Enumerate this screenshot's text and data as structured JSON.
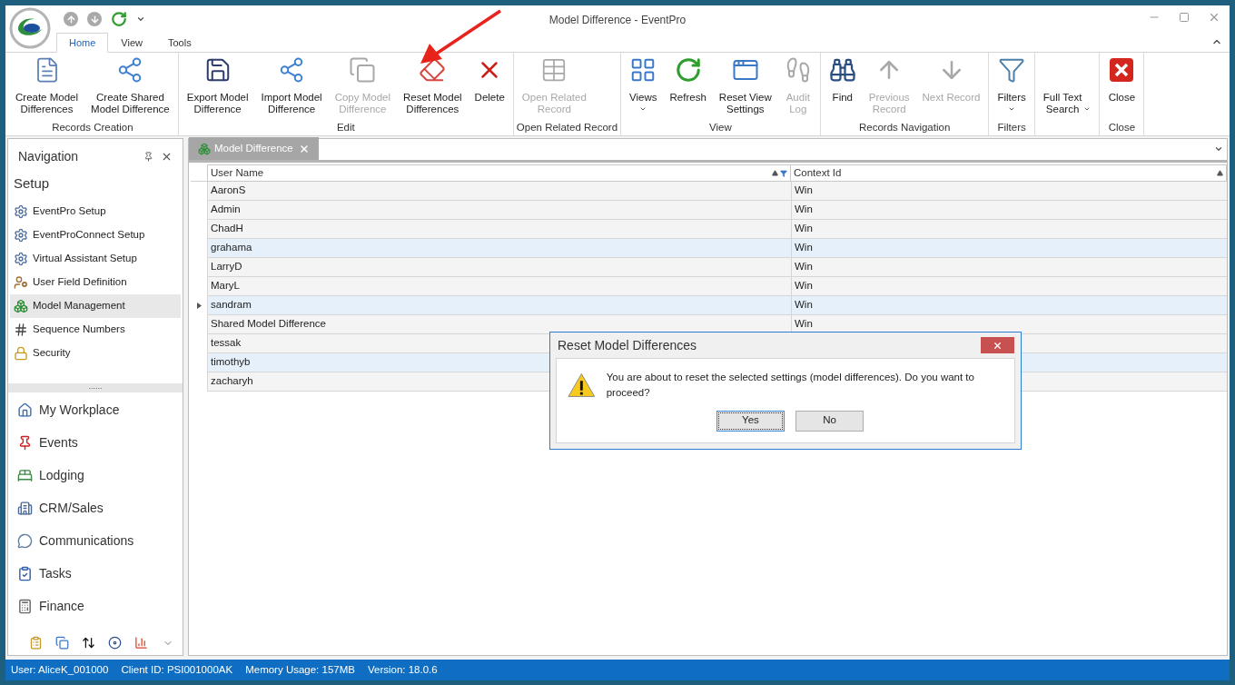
{
  "window": {
    "title": "Model Difference - EventPro"
  },
  "ribbon_tabs": [
    {
      "label": "Home",
      "selected": true
    },
    {
      "label": "View",
      "selected": false
    },
    {
      "label": "Tools",
      "selected": false
    }
  ],
  "ribbon_groups": [
    {
      "label": "Records Creation",
      "buttons": [
        {
          "label": "Create Model\nDifferences",
          "disabled": false,
          "menu": false
        },
        {
          "label": "Create Shared\nModel Difference",
          "disabled": false,
          "menu": false
        }
      ]
    },
    {
      "label": "Edit",
      "buttons": [
        {
          "label": "Export Model\nDifference",
          "disabled": false,
          "menu": false
        },
        {
          "label": "Import Model\nDifference",
          "disabled": false,
          "menu": false
        },
        {
          "label": "Copy Model\nDifference",
          "disabled": true,
          "menu": false
        },
        {
          "label": "Reset Model\nDifferences",
          "disabled": false,
          "menu": false
        },
        {
          "label": "Delete",
          "disabled": false,
          "menu": false
        }
      ]
    },
    {
      "label": "Open Related Record",
      "buttons": [
        {
          "label": "Open Related\nRecord",
          "disabled": true,
          "menu": false
        }
      ]
    },
    {
      "label": "View",
      "buttons": [
        {
          "label": "Views",
          "disabled": false,
          "menu": true
        },
        {
          "label": "Refresh",
          "disabled": false,
          "menu": false
        },
        {
          "label": "Reset View\nSettings",
          "disabled": false,
          "menu": false
        },
        {
          "label": "Audit\nLog",
          "disabled": true,
          "menu": false
        }
      ]
    },
    {
      "label": "Records Navigation",
      "buttons": [
        {
          "label": "Find",
          "disabled": false,
          "menu": false
        },
        {
          "label": "Previous\nRecord",
          "disabled": true,
          "menu": false
        },
        {
          "label": "Next Record",
          "disabled": true,
          "menu": false
        }
      ]
    },
    {
      "label": "Filters",
      "buttons": [
        {
          "label": "Filters",
          "disabled": false,
          "menu": true
        }
      ]
    },
    {
      "buttons": [
        {
          "label": "Full Text\nSearch",
          "disabled": false,
          "menu": true
        }
      ]
    },
    {
      "label": "Close",
      "buttons": [
        {
          "label": "Close",
          "disabled": false,
          "menu": false
        }
      ]
    }
  ],
  "navigation": {
    "title": "Navigation",
    "section": "Setup",
    "items": [
      {
        "label": "EventPro Setup",
        "selected": false
      },
      {
        "label": "EventProConnect Setup",
        "selected": false
      },
      {
        "label": "Virtual Assistant Setup",
        "selected": false
      },
      {
        "label": "User Field Definition",
        "selected": false
      },
      {
        "label": "Model Management",
        "selected": true
      },
      {
        "label": "Sequence Numbers",
        "selected": false
      },
      {
        "label": "Security",
        "selected": false
      }
    ],
    "splitter": "......",
    "modules": [
      "My Workplace",
      "Events",
      "Lodging",
      "CRM/Sales",
      "Communications",
      "Tasks",
      "Finance"
    ]
  },
  "document_tab": {
    "label": "Model Difference"
  },
  "table": {
    "columns": [
      {
        "label": "User Name",
        "filtered": true
      },
      {
        "label": "Context Id",
        "filtered": false
      }
    ],
    "rows": [
      {
        "user_name": "AaronS",
        "context_id": "Win",
        "selected": false,
        "current": false
      },
      {
        "user_name": "Admin",
        "context_id": "Win",
        "selected": false,
        "current": false
      },
      {
        "user_name": "ChadH",
        "context_id": "Win",
        "selected": false,
        "current": false
      },
      {
        "user_name": "grahama",
        "context_id": "Win",
        "selected": true,
        "current": false
      },
      {
        "user_name": "LarryD",
        "context_id": "Win",
        "selected": false,
        "current": false
      },
      {
        "user_name": "MaryL",
        "context_id": "Win",
        "selected": false,
        "current": false
      },
      {
        "user_name": "sandram",
        "context_id": "Win",
        "selected": true,
        "current": true
      },
      {
        "user_name": "Shared Model Difference",
        "context_id": "Win",
        "selected": false,
        "current": false
      },
      {
        "user_name": "tessak",
        "selected": false,
        "current": false
      },
      {
        "user_name": "timothyb",
        "selected": true,
        "current": false
      },
      {
        "user_name": "zacharyh",
        "selected": false,
        "current": false
      }
    ]
  },
  "dialog": {
    "title": "Reset Model Differences",
    "message": "You are about to reset the selected settings (model differences). Do you want to proceed?",
    "buttons": [
      {
        "label": "Yes",
        "selected": true
      },
      {
        "label": "No",
        "selected": false
      }
    ]
  },
  "status_bar": [
    "User: AliceK_001000",
    "Client ID: PSI001000AK",
    "Memory Usage: 157MB",
    "Version: 18.0.6"
  ]
}
